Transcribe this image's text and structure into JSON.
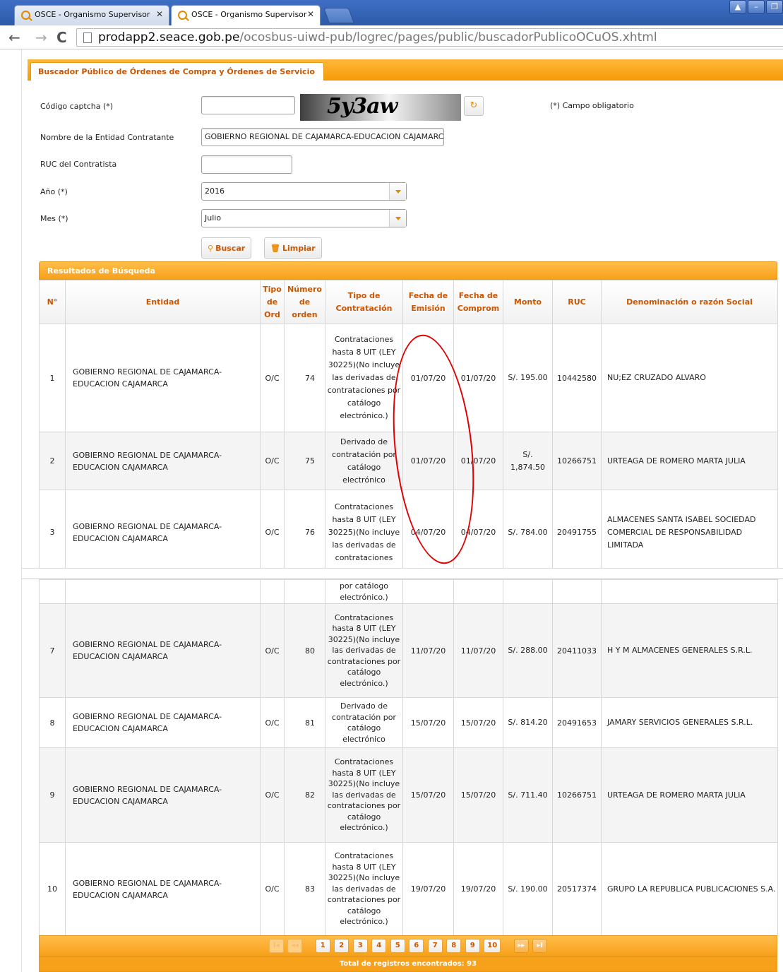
{
  "browser": {
    "tabs": [
      {
        "title": "OSCE - Organismo Supervisor"
      },
      {
        "title": "OSCE - Organismo Supervisor"
      }
    ],
    "url_host": "prodapp2.seace.gob.pe",
    "url_path": "/ocosbus-uiwd-pub/logrec/pages/public/buscadorPublicoOCuOS.xhtml"
  },
  "page": {
    "tab_title": "Buscador Público de Órdenes de Compra y Órdenes de Servicio",
    "form": {
      "captcha_label": "Código captcha (*)",
      "captcha_value": "",
      "captcha_text": "5y3aw",
      "required_note": "(*) Campo obligatorio",
      "entity_label": "Nombre de la Entidad Contratante",
      "entity_value": "GOBIERNO REGIONAL DE CAJAMARCA-EDUCACION CAJAMARC",
      "ruc_label": "RUC del Contratista",
      "ruc_value": "",
      "year_label": "Año (*)",
      "year_value": "2016",
      "month_label": "Mes (*)",
      "month_value": "Julio",
      "search_button": "Buscar",
      "clear_button": "Limpiar"
    },
    "results": {
      "title": "Resultados de Búsqueda",
      "columns": [
        "N°",
        "Entidad",
        "Tipo de Ord",
        "Número de orden",
        "Tipo de Contratación",
        "Fecha de Emisión",
        "Fecha de Comprom",
        "Monto",
        "RUC",
        "Denominación o razón Social"
      ],
      "rows": [
        {
          "n": "1",
          "entidad": "GOBIERNO REGIONAL DE CAJAMARCA-EDUCACION CAJAMARCA",
          "tipo": "O/C",
          "numero": "74",
          "contratacion": "Contrataciones hasta 8 UIT (LEY 30225)(No incluye las derivadas de contrataciones por catálogo electrónico.)",
          "emision": "01/07/20",
          "compromiso": "01/07/20",
          "monto": "S/. 195.00",
          "ruc": "10442580",
          "razon": "NU;EZ CRUZADO ALVARO"
        },
        {
          "n": "2",
          "entidad": "GOBIERNO REGIONAL DE CAJAMARCA-EDUCACION CAJAMARCA",
          "tipo": "O/C",
          "numero": "75",
          "contratacion": "Derivado de contratación por catálogo electrónico",
          "emision": "01/07/20",
          "compromiso": "01/07/20",
          "monto": "S/. 1,874.50",
          "ruc": "10266751",
          "razon": "URTEAGA DE ROMERO MARTA JULIA"
        },
        {
          "n": "3",
          "entidad": "GOBIERNO REGIONAL DE CAJAMARCA-EDUCACION CAJAMARCA",
          "tipo": "O/C",
          "numero": "76",
          "contratacion": "Contrataciones hasta 8 UIT (LEY 30225)(No incluye las derivadas de contrataciones",
          "emision": "04/07/20",
          "compromiso": "04/07/20",
          "monto": "S/. 784.00",
          "ruc": "20491755",
          "razon": "ALMACENES SANTA ISABEL SOCIEDAD COMERCIAL DE RESPONSABILIDAD LIMITADA"
        }
      ],
      "continuation_text": "por catálogo electrónico.)",
      "rows2": [
        {
          "n": "7",
          "entidad": "GOBIERNO REGIONAL DE CAJAMARCA-EDUCACION CAJAMARCA",
          "tipo": "O/C",
          "numero": "80",
          "contratacion": "Contrataciones hasta 8 UIT (LEY 30225)(No incluye las derivadas de contrataciones por catálogo electrónico.)",
          "emision": "11/07/20",
          "compromiso": "11/07/20",
          "monto": "S/. 288.00",
          "ruc": "20411033",
          "razon": "H Y M ALMACENES GENERALES S.R.L."
        },
        {
          "n": "8",
          "entidad": "GOBIERNO REGIONAL DE CAJAMARCA-EDUCACION CAJAMARCA",
          "tipo": "O/C",
          "numero": "81",
          "contratacion": "Derivado de contratación por catálogo electrónico",
          "emision": "15/07/20",
          "compromiso": "15/07/20",
          "monto": "S/. 814.20",
          "ruc": "20491653",
          "razon": "JAMARY SERVICIOS GENERALES S.R.L."
        },
        {
          "n": "9",
          "entidad": "GOBIERNO REGIONAL DE CAJAMARCA-EDUCACION CAJAMARCA",
          "tipo": "O/C",
          "numero": "82",
          "contratacion": "Contrataciones hasta 8 UIT (LEY 30225)(No incluye las derivadas de contrataciones por catálogo electrónico.)",
          "emision": "15/07/20",
          "compromiso": "15/07/20",
          "monto": "S/. 711.40",
          "ruc": "10266751",
          "razon": "URTEAGA DE ROMERO MARTA JULIA"
        },
        {
          "n": "10",
          "entidad": "GOBIERNO REGIONAL DE CAJAMARCA-EDUCACION CAJAMARCA",
          "tipo": "O/C",
          "numero": "83",
          "contratacion": "Contrataciones hasta 8 UIT (LEY 30225)(No incluye las derivadas de contrataciones por catálogo electrónico.)",
          "emision": "19/07/20",
          "compromiso": "19/07/20",
          "monto": "S/. 190.00",
          "ruc": "20517374",
          "razon": "GRUPO LA REPUBLICA PUBLICACIONES S.A."
        }
      ]
    },
    "pager": {
      "first": "I◂",
      "prev": "◂◂",
      "pages": [
        "1",
        "2",
        "3",
        "4",
        "5",
        "6",
        "7",
        "8",
        "9",
        "10"
      ],
      "next": "▸▸",
      "last": "▸I",
      "total": "Total de registros encontrados: 93"
    }
  },
  "colors": {
    "accent": "#f7a11a",
    "link": "#cc5500",
    "annotation": "#e00000"
  }
}
